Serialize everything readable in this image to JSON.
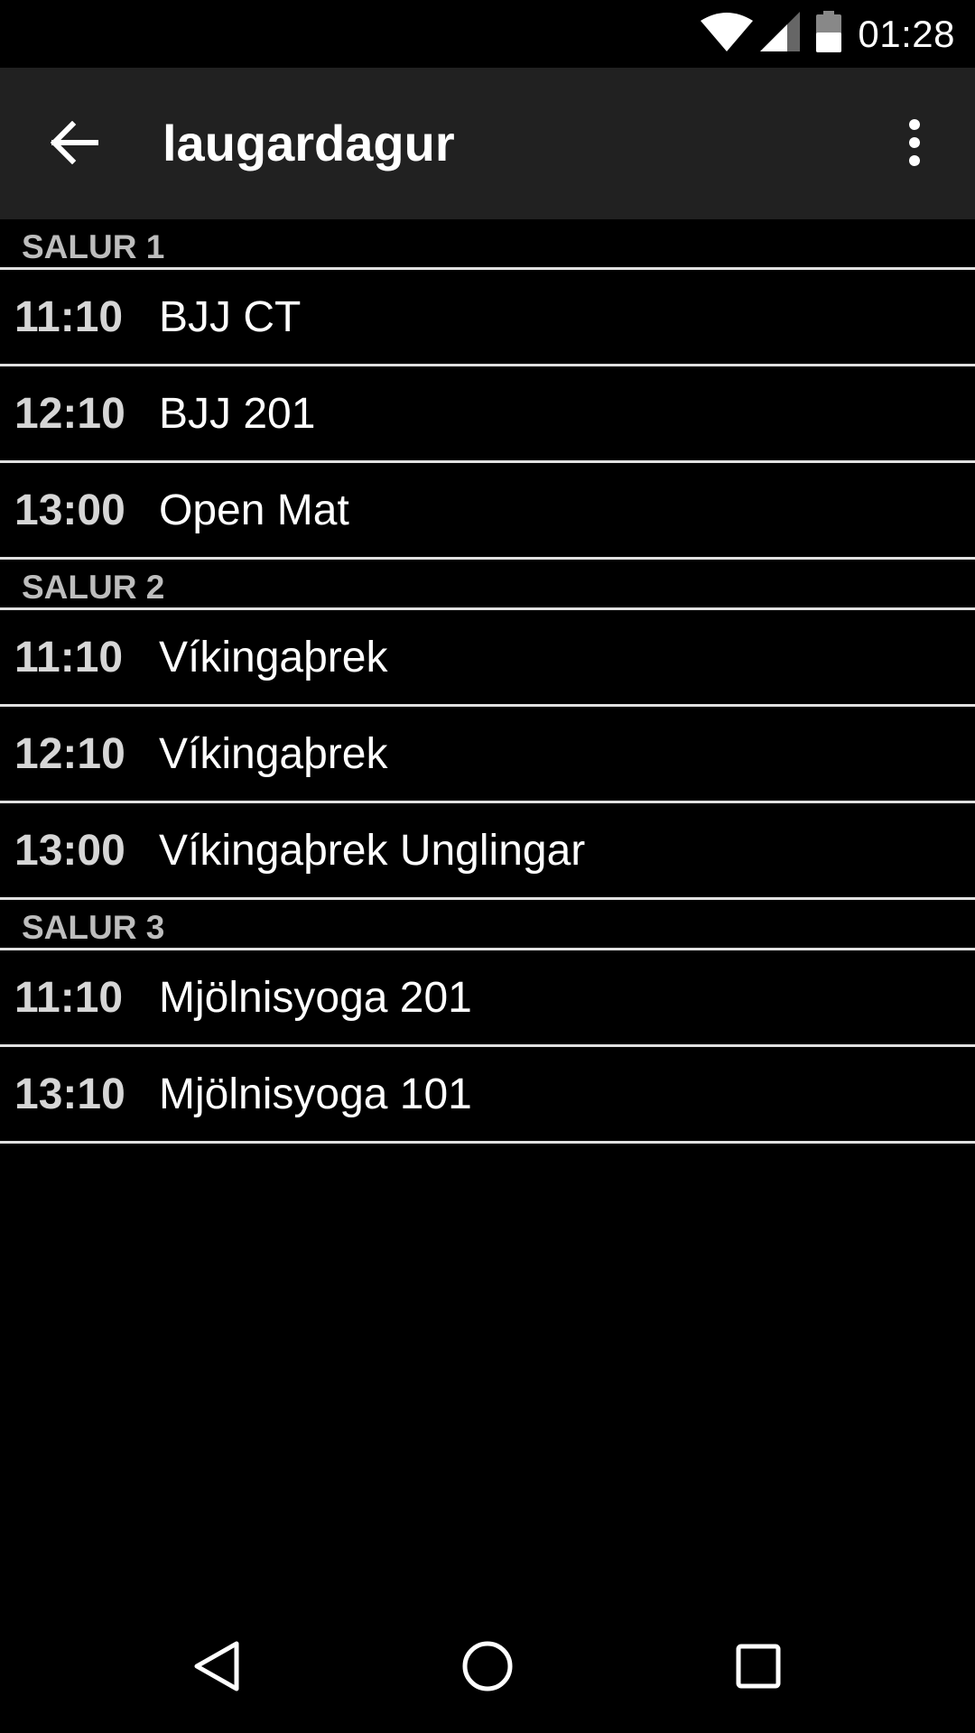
{
  "status_bar": {
    "time": "01:28",
    "icons": [
      "wifi-icon",
      "cell-signal-icon",
      "battery-icon"
    ]
  },
  "app_bar": {
    "title": "laugardagur",
    "back_icon": "arrow-back-icon",
    "menu_icon": "more-vert-icon"
  },
  "sections": [
    {
      "name": "SALUR 1",
      "classes": [
        {
          "time": "11:10",
          "name": "BJJ CT"
        },
        {
          "time": "12:10",
          "name": "BJJ 201"
        },
        {
          "time": "13:00",
          "name": "Open Mat"
        }
      ]
    },
    {
      "name": "SALUR 2",
      "classes": [
        {
          "time": "11:10",
          "name": "Víkingaþrek"
        },
        {
          "time": "12:10",
          "name": "Víkingaþrek"
        },
        {
          "time": "13:00",
          "name": "Víkingaþrek Unglingar"
        }
      ]
    },
    {
      "name": "SALUR 3",
      "classes": [
        {
          "time": "11:10",
          "name": "Mjölnisyoga 201"
        },
        {
          "time": "13:10",
          "name": "Mjölnisyoga 101"
        }
      ]
    }
  ],
  "nav_bar": {
    "icons": [
      "back-triangle-icon",
      "home-circle-icon",
      "recents-square-icon"
    ]
  },
  "colors": {
    "background": "#000000",
    "app_bar": "#212121",
    "divider": "#e0e0e0",
    "section_text": "#bdbdbd",
    "time_text": "#d6d6d6"
  }
}
